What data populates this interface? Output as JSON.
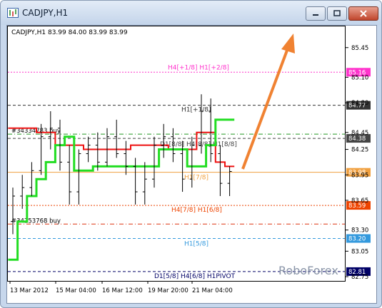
{
  "window": {
    "title": "CADJPY,H1",
    "controls": {
      "minimize": "minimize-icon",
      "maximize": "maximize-icon",
      "close": "close-icon"
    }
  },
  "chart_info": "CADJPY,H1  83.99 84.00 83.99 83.99",
  "watermark": "RoboForex",
  "colors": {
    "bull_green": "#22dd22",
    "bear_red": "#ee1111",
    "arrow": "#f08232",
    "grid": "#000000",
    "candle": "#000000"
  },
  "chart_data": {
    "type": "candlestick",
    "symbol": "CADJPY",
    "timeframe": "H1",
    "ohlc_header": {
      "open": 83.99,
      "high": 84.0,
      "low": 83.99,
      "close": 83.99
    },
    "ylim": [
      82.7,
      85.7
    ],
    "y_ticks": [
      "85.45",
      "85.10",
      "84.80",
      "84.45",
      "84.25",
      "83.95",
      "83.65",
      "83.30",
      "83.05",
      "82.75"
    ],
    "x_ticks": [
      "13 Mar 2012",
      "15 Mar 04:00",
      "16 Mar 12:00",
      "19 Mar 20:00",
      "21 Mar 04:00"
    ],
    "levels": [
      {
        "label": "H4[+1/8] H1[+2/8]",
        "price_label": "85.16",
        "value": 85.16,
        "color": "#ff33cc",
        "style": "dotted"
      },
      {
        "label": "H1[+1/8]",
        "price_label": "84.77",
        "value": 84.77,
        "color": "#333333",
        "style": "dashed"
      },
      {
        "label": "D1[8/8] H4[8/8] H1[8/8]",
        "price_label": "84.38",
        "value": 84.38,
        "color": "#444444",
        "style": "dashed"
      },
      {
        "label": "H1[7/8]",
        "price_label": "83.98",
        "value": 83.98,
        "color": "#f0a040",
        "style": "solid"
      },
      {
        "label": "H4[7/8] H1[6/8]",
        "price_label": "83.59",
        "value": 83.59,
        "color": "#ee4400",
        "style": "dotted"
      },
      {
        "label": "H1[5/8]",
        "price_label": "83.20",
        "value": 83.2,
        "color": "#3399dd",
        "style": "dashed"
      },
      {
        "label": "D1[5/8] H4[6/8] H1PIVOT",
        "price_label": "82.81",
        "value": 82.81,
        "color": "#000066",
        "style": "dashed"
      }
    ],
    "orders": [
      {
        "label": "#34334783 buy",
        "value": 84.43,
        "color": "#229922"
      },
      {
        "label": "#34253768 buy",
        "value": 83.37,
        "color": "#dd3311"
      }
    ],
    "candles": [
      {
        "o": 83.4,
        "h": 83.8,
        "l": 83.25,
        "c": 83.7
      },
      {
        "o": 83.7,
        "h": 83.95,
        "l": 83.55,
        "c": 83.8
      },
      {
        "o": 83.8,
        "h": 84.1,
        "l": 83.7,
        "c": 84.0
      },
      {
        "o": 84.0,
        "h": 84.55,
        "l": 83.95,
        "c": 84.4
      },
      {
        "o": 84.4,
        "h": 84.7,
        "l": 84.25,
        "c": 84.5
      },
      {
        "o": 84.5,
        "h": 84.6,
        "l": 84.0,
        "c": 84.1
      },
      {
        "o": 84.1,
        "h": 84.3,
        "l": 83.6,
        "c": 83.75
      },
      {
        "o": 83.75,
        "h": 84.25,
        "l": 83.6,
        "c": 84.2
      },
      {
        "o": 84.2,
        "h": 84.4,
        "l": 84.1,
        "c": 84.3
      },
      {
        "o": 84.3,
        "h": 84.45,
        "l": 84.0,
        "c": 84.1
      },
      {
        "o": 84.1,
        "h": 84.5,
        "l": 84.05,
        "c": 84.4
      },
      {
        "o": 84.4,
        "h": 84.6,
        "l": 84.15,
        "c": 84.2
      },
      {
        "o": 84.2,
        "h": 84.35,
        "l": 83.95,
        "c": 84.05
      },
      {
        "o": 84.05,
        "h": 84.15,
        "l": 83.6,
        "c": 83.75
      },
      {
        "o": 83.75,
        "h": 84.1,
        "l": 83.6,
        "c": 83.9
      },
      {
        "o": 83.9,
        "h": 84.4,
        "l": 83.8,
        "c": 84.3
      },
      {
        "o": 84.3,
        "h": 84.55,
        "l": 84.15,
        "c": 84.4
      },
      {
        "o": 84.4,
        "h": 84.5,
        "l": 84.1,
        "c": 84.2
      },
      {
        "o": 84.2,
        "h": 84.35,
        "l": 83.75,
        "c": 83.9
      },
      {
        "o": 83.9,
        "h": 84.4,
        "l": 83.8,
        "c": 84.3
      },
      {
        "o": 84.3,
        "h": 84.9,
        "l": 84.2,
        "c": 84.7
      },
      {
        "o": 84.7,
        "h": 84.85,
        "l": 84.1,
        "c": 84.2
      },
      {
        "o": 84.2,
        "h": 84.3,
        "l": 83.7,
        "c": 83.85
      },
      {
        "o": 83.85,
        "h": 84.05,
        "l": 83.7,
        "c": 83.99
      }
    ],
    "resistance_line_red": [
      84.5,
      84.5,
      84.5,
      84.45,
      84.45,
      84.3,
      84.3,
      84.3,
      84.25,
      84.25,
      84.25,
      84.25,
      84.25,
      84.3,
      84.3,
      84.3,
      84.3,
      84.25,
      84.25,
      84.25,
      84.45,
      84.45,
      84.1,
      84.05
    ],
    "support_line_green": [
      82.95,
      83.4,
      83.7,
      83.9,
      84.1,
      84.3,
      84.4,
      84.0,
      84.0,
      84.05,
      84.05,
      84.05,
      84.05,
      84.05,
      84.05,
      84.05,
      84.25,
      84.25,
      84.25,
      84.05,
      84.05,
      84.3,
      84.6,
      84.6
    ]
  }
}
